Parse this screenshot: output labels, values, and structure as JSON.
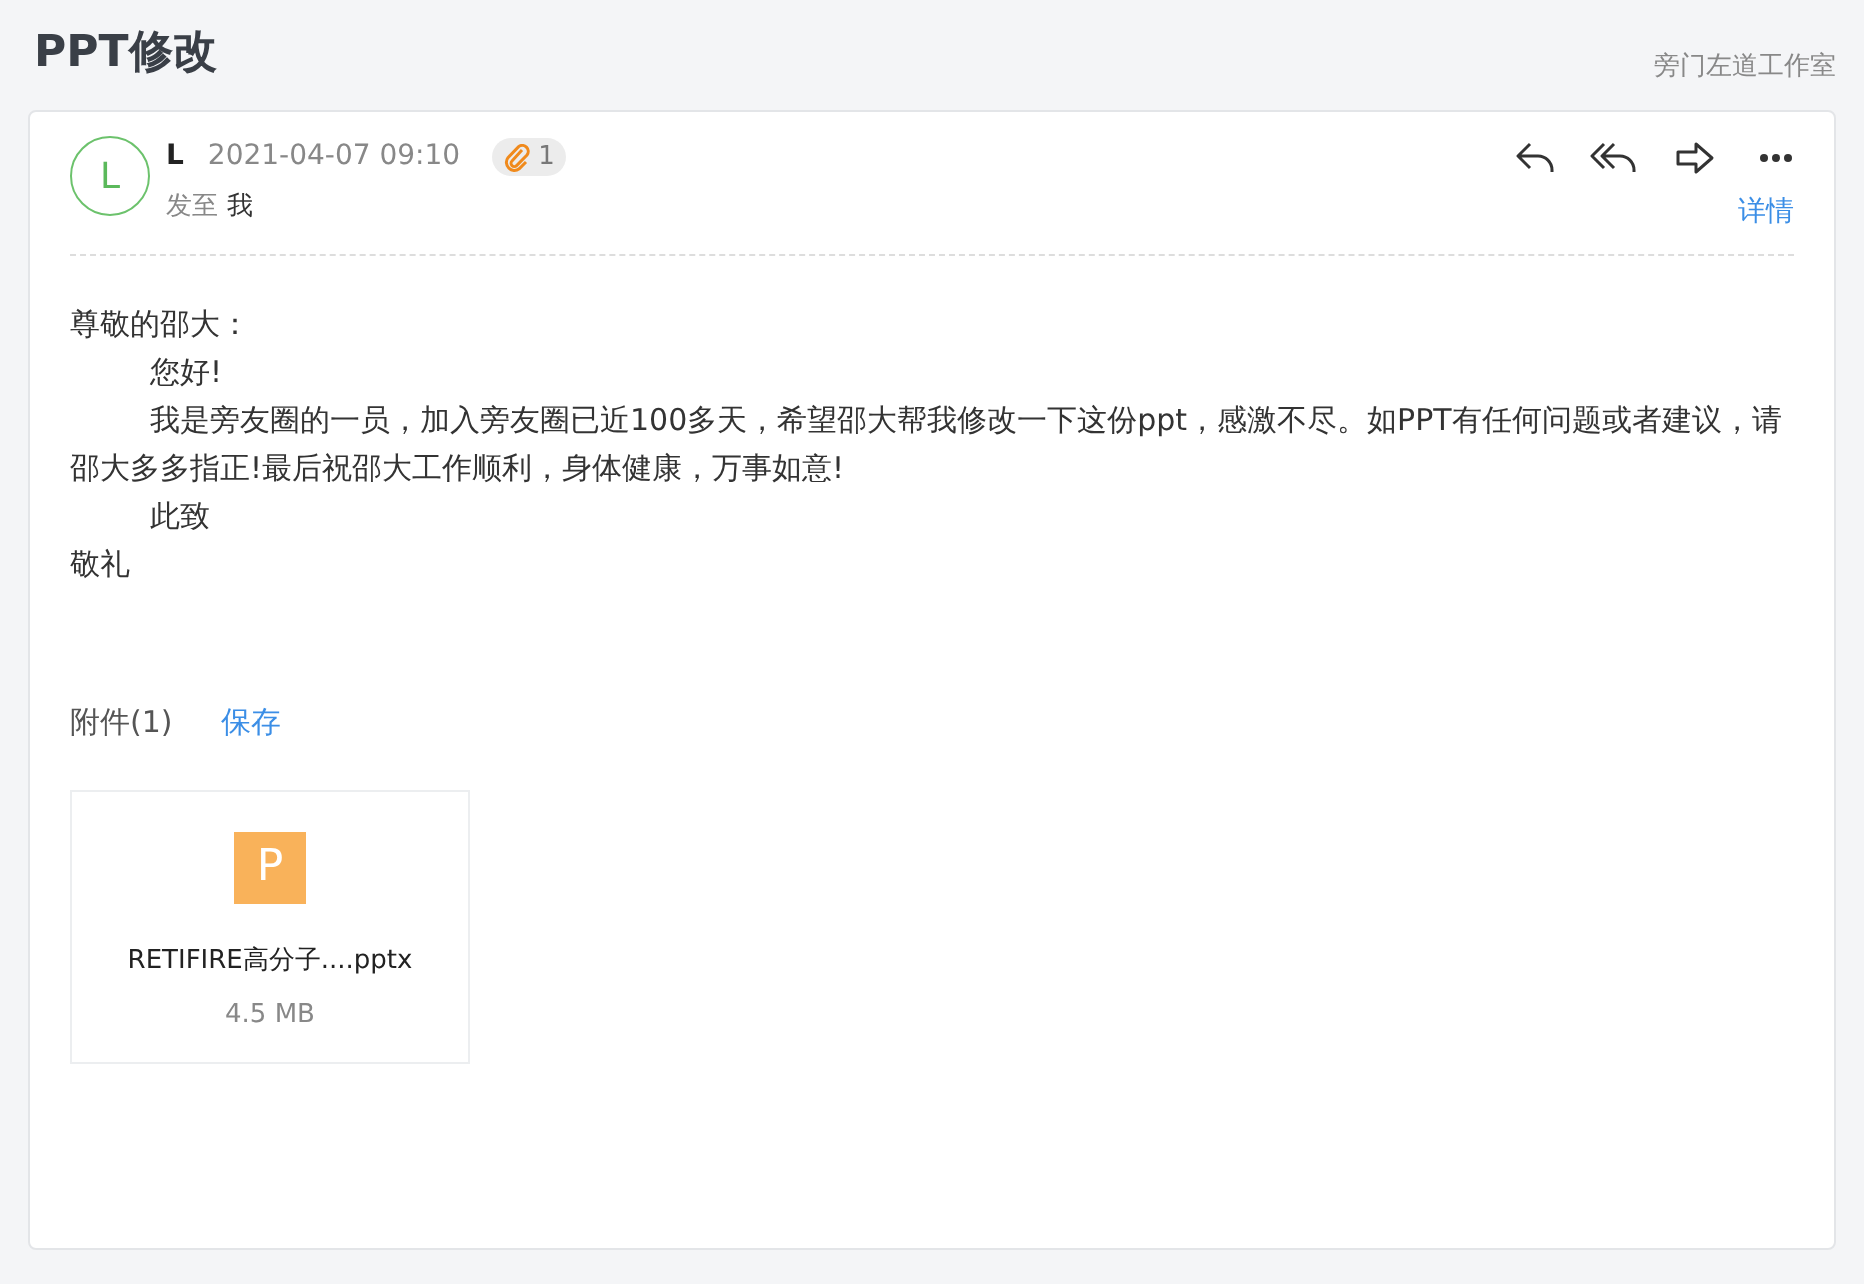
{
  "page": {
    "title": "PPT修改",
    "studio": "旁门左道工作室"
  },
  "mail": {
    "avatar": "L",
    "sender": "L",
    "date": "2021-04-07 09:10",
    "attachment_count": "1",
    "to_label": "发至",
    "to": "我",
    "details_link": "详情"
  },
  "body": [
    {
      "text": "尊敬的邵大：",
      "indent": false
    },
    {
      "text": "您好!",
      "indent": true
    },
    {
      "text": "我是旁友圈的一员，加入旁友圈已近100多天，希望邵大帮我修改一下这份ppt，感激不尽。如PPT有任何问题或者建议，请邵大多多指正!最后祝邵大工作顺利，身体健康，万事如意!",
      "indent": true
    },
    {
      "text": "此致",
      "indent": true
    },
    {
      "text": "敬礼",
      "indent": false
    }
  ],
  "attachments": {
    "heading": "附件(1)",
    "save": "保存",
    "files": [
      {
        "icon_letter": "P",
        "name": "RETIFIRE高分子....pptx",
        "size": "4.5 MB"
      }
    ]
  }
}
